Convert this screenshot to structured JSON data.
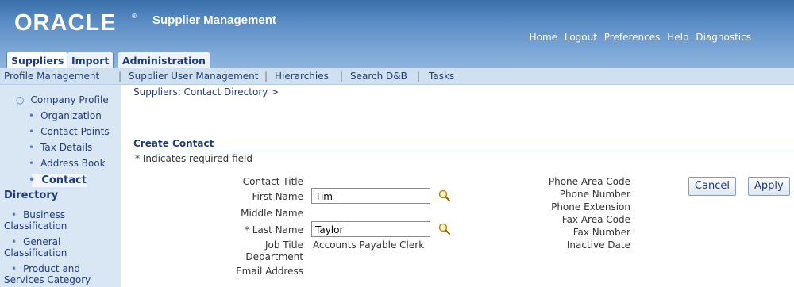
{
  "header": {
    "logo": "ORACLE",
    "logo_mark": "®",
    "app_title": "Supplier Management",
    "global_links": [
      "Home",
      "Logout",
      "Preferences",
      "Help",
      "Diagnostics"
    ]
  },
  "tabs": [
    "Suppliers",
    "Import",
    "Administration"
  ],
  "subnav": [
    "Profile Management",
    "Supplier User Management",
    "Hierarchies",
    "Search D&B",
    "Tasks"
  ],
  "sidebar": {
    "items": [
      "Company Profile",
      "Organization",
      "Contact Points",
      "Tax Details",
      "Address Book",
      "Contact",
      "Directory",
      "Business",
      "Classification",
      "General",
      "Classification",
      "Product and",
      "Services Category"
    ]
  },
  "breadcrumb": "Suppliers: Contact Directory  >",
  "section": {
    "title": "Create Contact",
    "required_note": "* Indicates required field"
  },
  "buttons": {
    "cancel": "Cancel",
    "apply": "Apply"
  },
  "form": {
    "contact_title_label": "Contact Title",
    "first_name_label": "First Name",
    "first_name_value": "Tim",
    "middle_name_label": "Middle Name",
    "last_name_label": "* Last Name",
    "last_name_value": "Taylor",
    "job_title_label": "Job Title",
    "job_title_value": "Accounts Payable Clerk",
    "department_label": "Department",
    "email_label": "Email Address",
    "phone_area_code_label": "Phone Area Code",
    "phone_number_label": "Phone Number",
    "phone_extension_label": "Phone Extension",
    "fax_area_code_label": "Fax Area Code",
    "fax_number_label": "Fax Number",
    "inactive_date_label": "Inactive Date"
  }
}
